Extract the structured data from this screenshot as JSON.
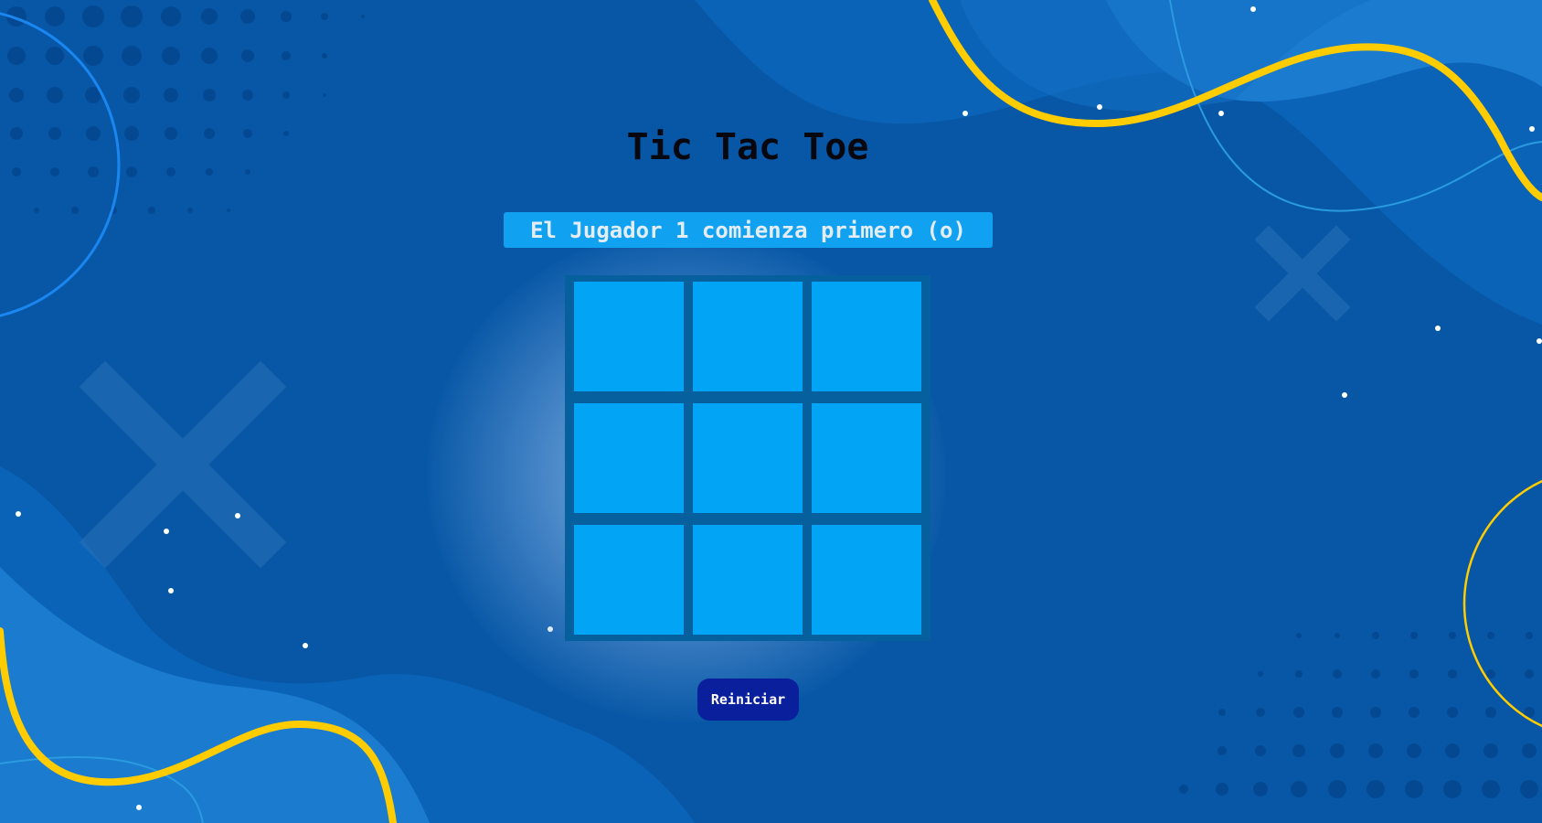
{
  "game": {
    "title": "Tic Tac Toe",
    "status": "El Jugador 1 comienza primero (o)",
    "board": [
      "",
      "",
      "",
      "",
      "",
      "",
      "",
      "",
      ""
    ],
    "restart_label": "Reiniciar"
  },
  "colors": {
    "background": "#0757a6",
    "cell": "#02a5f6",
    "board_frame": "#06609e",
    "status_banner": "#10a2f0",
    "restart_button": "#0a1f9c",
    "accent_yellow": "#ffcc00"
  }
}
